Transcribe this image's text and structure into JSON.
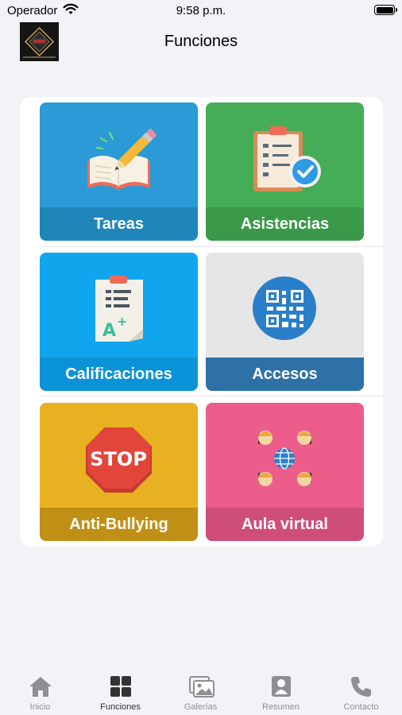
{
  "status": {
    "carrier": "Operador",
    "time": "9:58 p.m."
  },
  "header": {
    "title": "Funciones"
  },
  "tiles": [
    {
      "label": "Tareas",
      "color": "#2a9bd6",
      "bar_color": "#1f86ba",
      "icon": "book-pencil-icon"
    },
    {
      "label": "Asistencias",
      "color": "#45ad55",
      "bar_color": "#3a9948",
      "icon": "clipboard-check-icon"
    },
    {
      "label": "Calificaciones",
      "color": "#10a6ee",
      "bar_color": "#0b93d8",
      "icon": "grade-sheet-icon"
    },
    {
      "label": "Accesos",
      "color": "#e6e6e6",
      "bar_color": "#2d71a6",
      "icon": "qr-code-icon"
    },
    {
      "label": "Anti-Bullying",
      "color": "#e8b121",
      "bar_color": "#c08f16",
      "icon": "stop-sign-icon"
    },
    {
      "label": "Aula virtual",
      "color": "#ec5d8b",
      "bar_color": "#cf4e79",
      "icon": "virtual-classroom-icon"
    }
  ],
  "stop_text": "STOP",
  "tabs": [
    {
      "label": "Inicio",
      "icon": "home-icon",
      "active": false
    },
    {
      "label": "Funciones",
      "icon": "grid-icon",
      "active": true
    },
    {
      "label": "Galerías",
      "icon": "gallery-icon",
      "active": false
    },
    {
      "label": "Resumen",
      "icon": "resume-icon",
      "active": false
    },
    {
      "label": "Contacto",
      "icon": "phone-icon",
      "active": false
    }
  ],
  "colors": {
    "background": "#f2f2f7",
    "tab_inactive": "#8e8e93",
    "tab_active": "#333333"
  }
}
